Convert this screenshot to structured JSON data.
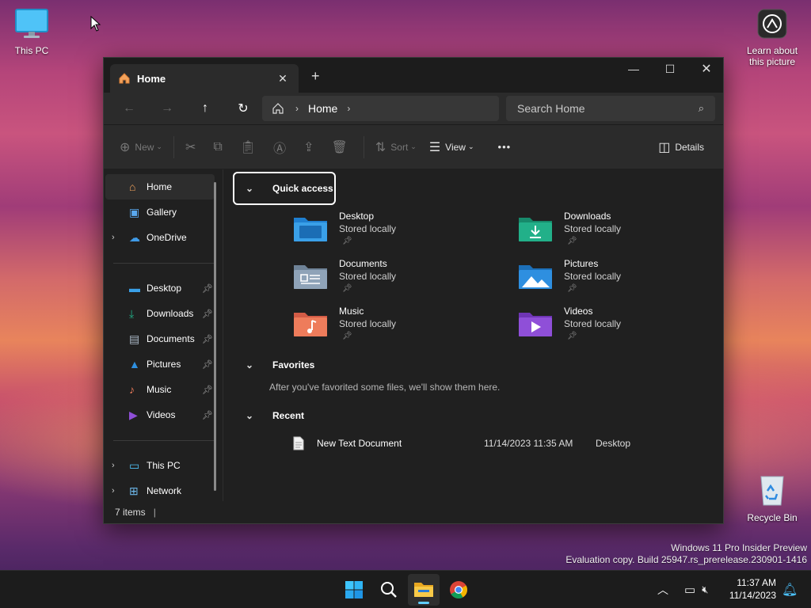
{
  "desktop": {
    "this_pc_label": "This PC",
    "learn_about_label_1": "Learn about",
    "learn_about_label_2": "this picture",
    "recycle_bin_label": "Recycle Bin"
  },
  "window": {
    "tab_title": "Home",
    "new_tab_symbol": "+",
    "address": {
      "crumb": "Home"
    },
    "search_placeholder": "Search Home",
    "commands": {
      "new": "New",
      "sort": "Sort",
      "view": "View",
      "more": "•••",
      "details": "Details"
    },
    "sidebar": {
      "top": [
        {
          "label": "Home",
          "icon": "home-icon"
        },
        {
          "label": "Gallery",
          "icon": "gallery-icon"
        },
        {
          "label": "OneDrive",
          "icon": "cloud-icon"
        }
      ],
      "pinned": [
        {
          "label": "Desktop",
          "icon": "desktop-folder-icon"
        },
        {
          "label": "Downloads",
          "icon": "download-icon"
        },
        {
          "label": "Documents",
          "icon": "documents-icon"
        },
        {
          "label": "Pictures",
          "icon": "pictures-icon"
        },
        {
          "label": "Music",
          "icon": "music-icon"
        },
        {
          "label": "Videos",
          "icon": "videos-icon"
        }
      ],
      "bottom": [
        {
          "label": "This PC",
          "icon": "pc-icon"
        },
        {
          "label": "Network",
          "icon": "network-icon"
        }
      ]
    },
    "quick_access": {
      "heading": "Quick access",
      "items": [
        {
          "name": "Desktop",
          "status": "Stored locally",
          "color": "#3aa0e8"
        },
        {
          "name": "Downloads",
          "status": "Stored locally",
          "color": "#22b089"
        },
        {
          "name": "Documents",
          "status": "Stored locally",
          "color": "#8fa3b8"
        },
        {
          "name": "Pictures",
          "status": "Stored locally",
          "color": "#2e8fe0"
        },
        {
          "name": "Music",
          "status": "Stored locally",
          "color": "#ee7c5b"
        },
        {
          "name": "Videos",
          "status": "Stored locally",
          "color": "#8f4fd8"
        }
      ]
    },
    "favorites": {
      "heading": "Favorites",
      "empty_text": "After you've favorited some files, we'll show them here."
    },
    "recent": {
      "heading": "Recent",
      "items": [
        {
          "name": "New Text Document",
          "date": "11/14/2023 11:35 AM",
          "location": "Desktop"
        }
      ]
    },
    "status": {
      "count": "7 items"
    }
  },
  "watermark": {
    "line1": "Windows 11 Pro Insider Preview",
    "line2": "Evaluation copy. Build 25947.rs_prerelease.230901-1416"
  },
  "taskbar": {
    "apps": [
      "start-icon",
      "search-icon",
      "file-explorer-icon",
      "chrome-icon"
    ],
    "time": "11:37 AM",
    "date": "11/14/2023"
  }
}
